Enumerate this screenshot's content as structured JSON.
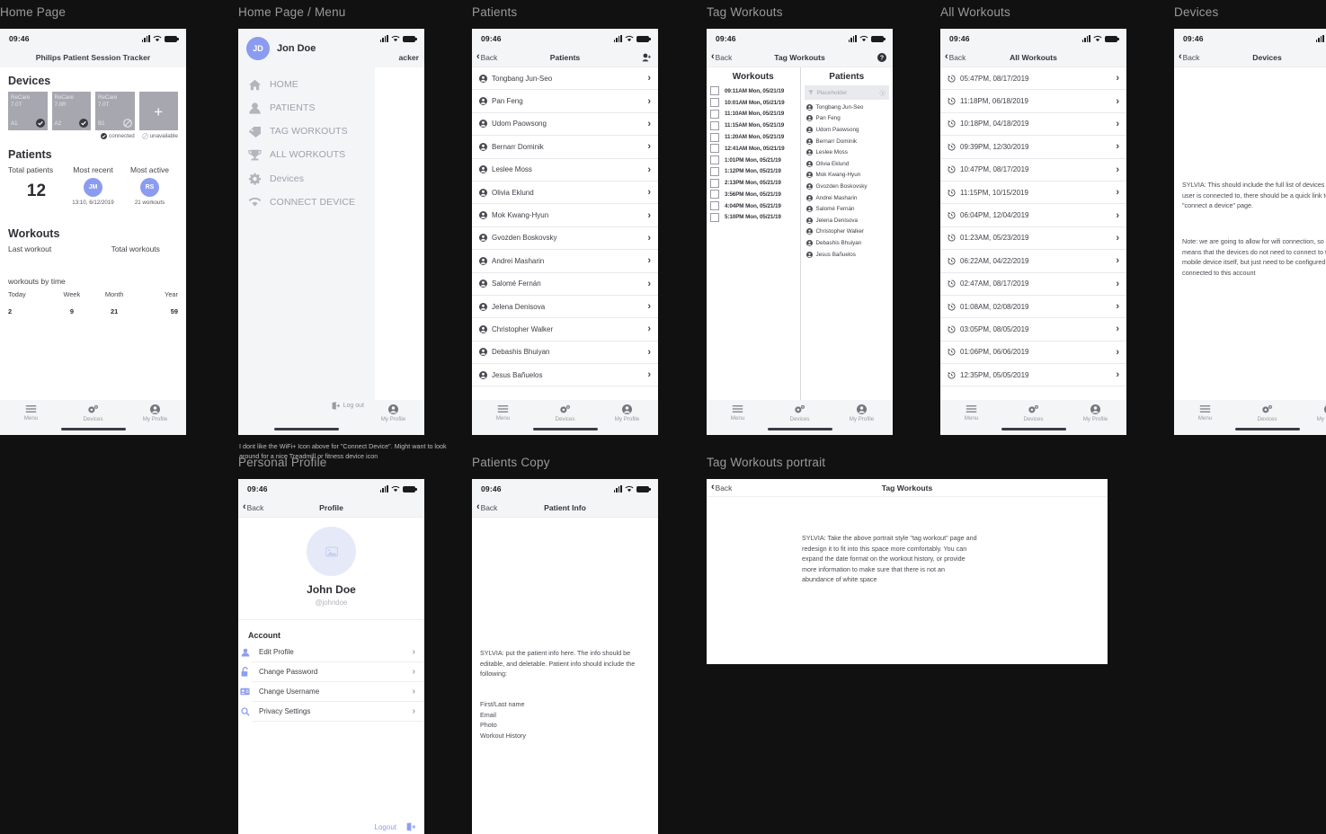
{
  "artboards": {
    "home": "Home Page",
    "menu": "Home Page / Menu",
    "patients": "Patients",
    "tag_workouts": "Tag Workouts",
    "all_workouts": "All Workouts",
    "devices": "Devices",
    "personal_profile": "Personal Profile",
    "patients_copy": "Patients Copy",
    "tag_workouts_portrait": "Tag Workouts portrait"
  },
  "annotations": {
    "menu_note": "I dont like the WiFi+ Icon above for \"Connect Device\". Might want to look around for a nice Treadmill or fitness device icon"
  },
  "status_bar": {
    "time": "09:46"
  },
  "tabbar": {
    "menu": "Menu",
    "devices": "Devices",
    "profile": "My Profile"
  },
  "home": {
    "app_title": "Philips Patient Session Tracker",
    "devices_heading": "Devices",
    "device_cards": [
      {
        "name": "ReCare",
        "model": "7.0T",
        "slot": "A1",
        "state": "connected"
      },
      {
        "name": "ReCare",
        "model": "7.0R",
        "slot": "A2",
        "state": "connected"
      },
      {
        "name": "ReCare",
        "model": "7.0T",
        "slot": "B1",
        "state": "unavailable"
      }
    ],
    "add_device_label": "+",
    "legend": {
      "connected": "connected",
      "unavailable": "unavailable"
    },
    "patients_heading": "Patients",
    "patient_stats": {
      "total_label": "Total patients",
      "total_value": "12",
      "most_recent_label": "Most recent",
      "most_recent_initials": "JM",
      "most_recent_sub": "13:10, 6/12/2019",
      "most_active_label": "Most active",
      "most_active_initials": "RS",
      "most_active_sub": "21 workouts"
    },
    "workouts_heading": "Workouts",
    "last_workout_label": "Last workout",
    "total_workouts_label": "Total workouts",
    "workouts_by_time_label": "workouts by time",
    "by_time": [
      {
        "label": "Today",
        "value": "2"
      },
      {
        "label": "Week",
        "value": "9"
      },
      {
        "label": "Month",
        "value": "21"
      },
      {
        "label": "Year",
        "value": "59"
      }
    ]
  },
  "menu": {
    "user_initials": "JD",
    "user_name": "Jon Doe",
    "items": [
      {
        "label": "HOME",
        "icon": "home-icon"
      },
      {
        "label": "PATIENTS",
        "icon": "person-icon"
      },
      {
        "label": "TAG WORKOUTS",
        "icon": "tag-icon"
      },
      {
        "label": "ALL WORKOUTS",
        "icon": "trophy-icon"
      },
      {
        "label": "Devices",
        "icon": "gear-icon"
      },
      {
        "label": "CONNECT DEVICE",
        "icon": "wifi-icon"
      }
    ],
    "logout": "Log out",
    "behind_title_fragment": "acker"
  },
  "patients": {
    "back": "Back",
    "title": "Patients",
    "names": [
      "Tongbang Jun-Seo",
      "Pan Feng",
      "Udom Paowsong",
      "Bernarr Dominik",
      "Leslee Moss",
      "Olivia Eklund",
      "Mok Kwang-Hyun",
      "Gvozden Boskovsky",
      "Andrei Masharin",
      "Salomé Fernán",
      "Jelena Denisova",
      "Christopher Walker",
      "Debashis Bhuiyan",
      "Jesus Bañuelos"
    ]
  },
  "tag_workouts": {
    "back": "Back",
    "title": "Tag Workouts",
    "workouts_col": "Workouts",
    "patients_col": "Patients",
    "filter_placeholder": "Placeholder",
    "workouts": [
      "09:11AM Mon, 05/21/19",
      "10:01AM Mon, 05/21/19",
      "11:10AM Mon, 05/21/19",
      "11:15AM Mon, 05/21/19",
      "11:20AM Mon, 05/21/19",
      "12:41AM Mon, 05/21/19",
      "1:01PM Mon, 05/21/19",
      "1:12PM Mon, 05/21/19",
      "2:13PM Mon, 05/21/19",
      "3:56PM Mon, 05/21/19",
      "4:04PM Mon, 05/21/19",
      "5:10PM Mon, 05/21/19"
    ],
    "patients": [
      "Tongbang Jun-Seo",
      "Pan Feng",
      "Udom Paowsong",
      "Bernarr Dominik",
      "Leslee Moss",
      "Olivia Eklund",
      "Mok Kwang-Hyun",
      "Gvozden Boskovsky",
      "Andrei Masharin",
      "Salomé Fernán",
      "Jelena Denisova",
      "Christopher Walker",
      "Debashis Bhuiyan",
      "Jesus Bañuelos"
    ]
  },
  "all_workouts": {
    "back": "Back",
    "title": "All Workouts",
    "entries": [
      "05:47PM, 08/17/2019",
      "11:18PM, 06/18/2019",
      "10:18PM, 04/18/2019",
      "09:39PM, 12/30/2019",
      "10:47PM, 08/17/2019",
      "11:15PM, 10/15/2019",
      "06:04PM, 12/04/2019",
      "01:23AM, 05/23/2019",
      "06:22AM, 04/22/2019",
      "02:47AM, 08/17/2019",
      "01:08AM, 02/08/2019",
      "03:05PM, 08/05/2019",
      "01:06PM, 06/06/2019",
      "12:35PM, 05/05/2019"
    ]
  },
  "devices_screen": {
    "back": "Back",
    "title": "Devices",
    "note_1": "SYLVIA: This should include the full list of devices that the user is connected to, there should be a quick link to the \"connect a device\" page.",
    "note_2": "Note: we are going to allow for wifi connection, so that means that the devices do not need to connect to the mobile device itself, but just need to be configured and connected to this account"
  },
  "profile": {
    "back": "Back",
    "title": "Profile",
    "name": "John Doe",
    "handle": "@johndoe",
    "section": "Account",
    "rows": [
      {
        "label": "Edit Profile",
        "icon": "person-icon"
      },
      {
        "label": "Change Password",
        "icon": "unlock-icon"
      },
      {
        "label": "Change Username",
        "icon": "id-card-icon"
      },
      {
        "label": "Privacy Settings",
        "icon": "search-icon"
      }
    ],
    "logout": "Logout"
  },
  "patient_info": {
    "back": "Back",
    "title": "Patient Info",
    "note": "SYLVIA: put the patient info here. The info should be editable, and deletable. Patient info should include the following:",
    "fields": [
      "First/Last name",
      "Email",
      "Photo",
      "Workout History"
    ]
  },
  "tag_workouts_portrait": {
    "back": "Back",
    "title": "Tag Workouts",
    "note": "SYLVIA: Take the above portrait style \"tag workout\" page and redesign it to fit into this space more comfortably. You can expand the date format on the workout history, or provide more information to make sure that there is not an abundance of white space"
  },
  "colors": {
    "canvas": "#111111",
    "chrome": "#f4f5f7",
    "accent": "#8b9cf0",
    "device_card": "#a7a7b0",
    "label": "#9a9a9a"
  }
}
